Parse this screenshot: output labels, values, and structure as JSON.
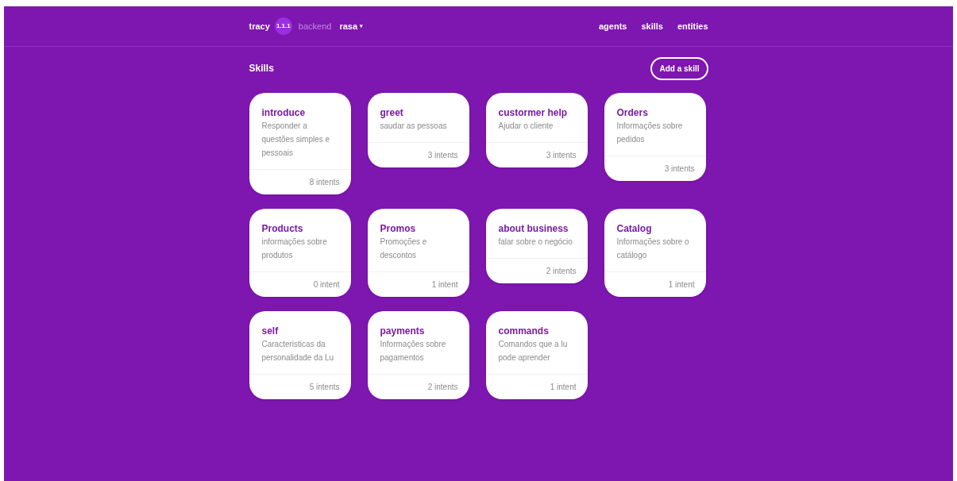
{
  "header": {
    "brand": "tracy",
    "version": "1.1.1",
    "backend_label": "backend",
    "backend_value": "rasa",
    "backend_caret": "▾",
    "nav": [
      {
        "label": "agents"
      },
      {
        "label": "skills"
      },
      {
        "label": "entities"
      }
    ]
  },
  "page": {
    "title": "Skills",
    "add_button": "Add a skill"
  },
  "skills": [
    {
      "name": "introduce",
      "description": "Responder a questões simples e pessoais",
      "count": "8 intents"
    },
    {
      "name": "greet",
      "description": "saudar as pessoas",
      "count": "3 intents"
    },
    {
      "name": "custormer help",
      "description": "Ajudar o cliente",
      "count": "3 intents"
    },
    {
      "name": "Orders",
      "description": "Informações sobre pedidos",
      "count": "3 intents"
    },
    {
      "name": "Products",
      "description": "informações sobre produtos",
      "count": "0 intent"
    },
    {
      "name": "Promos",
      "description": "Promoções e descontos",
      "count": "1 intent"
    },
    {
      "name": "about business",
      "description": "falar sobre o negócio",
      "count": "2 intents"
    },
    {
      "name": "Catalog",
      "description": "Informações sobre o catálogo",
      "count": "1 intent"
    },
    {
      "name": "self",
      "description": "Caracteristicas da personalidade da Lu",
      "count": "5 intents"
    },
    {
      "name": "payments",
      "description": "Informações sobre pagamentos",
      "count": "2 intents"
    },
    {
      "name": "commands",
      "description": "Comandos que a lu pode aprender",
      "count": "1 intent"
    }
  ]
}
